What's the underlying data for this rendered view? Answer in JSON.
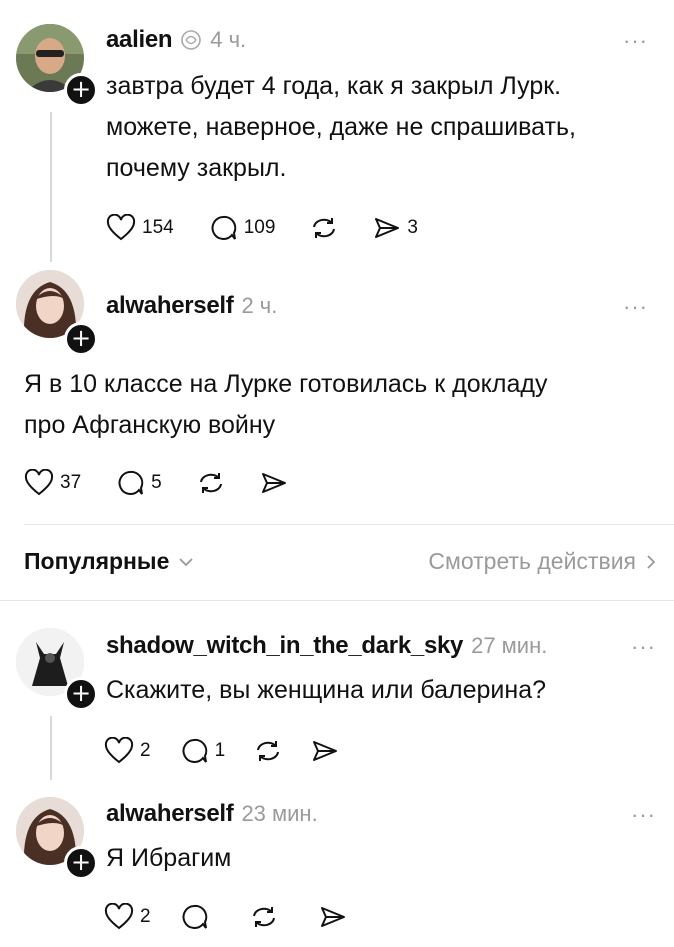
{
  "posts": [
    {
      "username": "aalien",
      "time": "4 ч.",
      "text_lines": [
        "завтра будет 4 года, как я закрыл Лурк.",
        "можете, наверное, даже не спрашивать,",
        "почему закрыл."
      ],
      "likes": "154",
      "comments": "109",
      "shares": "3"
    },
    {
      "username": "alwaherself",
      "time": "2 ч.",
      "text_lines": [
        "Я в 10 классе на Лурке готовилась к докладу",
        "про Афганскую войну"
      ],
      "likes": "37",
      "comments": "5"
    }
  ],
  "sort_bar": {
    "label": "Популярные",
    "view_activity": "Смотреть действия"
  },
  "replies": [
    {
      "username": "shadow_witch_in_the_dark_sky",
      "time": "27 мин.",
      "text": "Скажите, вы женщина или балерина?",
      "likes": "2",
      "comments": "1"
    },
    {
      "username": "alwaherself",
      "time": "23 мин.",
      "text": "Я Ибрагим",
      "likes": "2"
    }
  ],
  "more_label": "···",
  "plus_label": "+",
  "icons": {
    "verified": "verified-icon",
    "like": "heart-icon",
    "comment": "comment-icon",
    "repost": "repost-icon",
    "share": "share-icon",
    "chevron": "chevron-down-icon",
    "chevron_right": "chevron-right-icon"
  }
}
